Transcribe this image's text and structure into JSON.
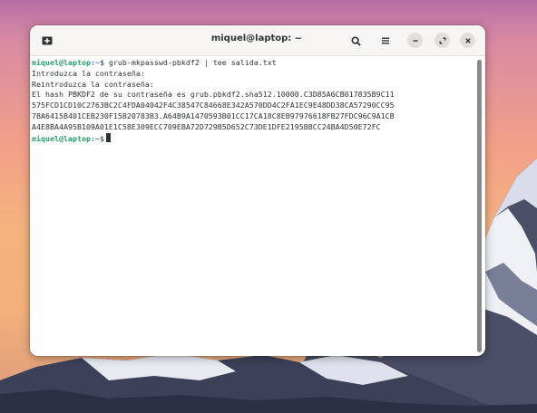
{
  "window": {
    "title": "miquel@laptop: ~"
  },
  "terminal": {
    "user_host": "miquel@laptop",
    "path_suffix": ":~",
    "command_line": "$ grub-mkpasswd-pbkdf2 | tee salida.txt",
    "line_prompt_pass": "Introduzca la contraseña:",
    "line_reprompt_pass": "Reintroduzca la contraseña:",
    "hash_lines": [
      "El hash PBKDF2 de su contraseña es grub.pbkdf2.sha512.10000.C3D85A6CB017835B9C11",
      "575FCD1CD10C2763BC2C4FDA04042F4C38547C84668E342A570DD4C2FA1EC9E48DD38CA57290CC95",
      "7BA6415B401CEB230F15B20783B3.A64B9A1470593B01CC17CA18C8EB97976618FB27FDC96C9A1CB",
      "A4E8BA4A95B109A01E1C58E309ECC709EBA72D729B5D652C73DE1DFE2195BBCC24BA4D50E72FC"
    ],
    "final_prompt_suffix": "$"
  },
  "colors": {
    "prompt_green": "#26a269",
    "path_blue": "#2a7bde",
    "text": "#2e3436"
  },
  "icons": {
    "new_tab": "new-tab-icon",
    "search": "search-icon",
    "menu": "hamburger-menu-icon",
    "minimize": "minimize-icon",
    "maximize": "maximize-icon",
    "close": "close-icon"
  }
}
